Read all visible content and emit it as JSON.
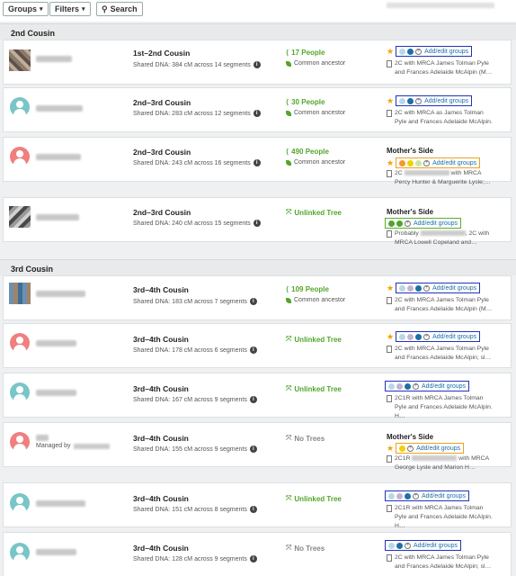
{
  "toolbar": {
    "groups_label": "Groups",
    "filters_label": "Filters",
    "search_label": "Search"
  },
  "sections": [
    {
      "title": "2nd Cousin"
    },
    {
      "title": "3rd Cousin"
    }
  ],
  "matches": [
    {
      "relationship": "1st–2nd Cousin",
      "dna": "Shared DNA: 384 cM across 14 segments",
      "tree": "17 People",
      "tree_sub": "Common ancestor",
      "side": "",
      "add_groups": "Add/edit groups",
      "note": "2C with MRCA James Tolman Pyle and Frances Adelaide McAlpin (M…"
    },
    {
      "relationship": "2nd–3rd Cousin",
      "dna": "Shared DNA: 283 cM across 12 segments",
      "tree": "30 People",
      "tree_sub": "Common ancestor",
      "side": "",
      "add_groups": "Add/edit groups",
      "note": "2C with MRCA as James Tolman Pyle and Frances Adelaide McAlpin."
    },
    {
      "relationship": "2nd–3rd Cousin",
      "dna": "Shared DNA: 243 cM across 16 segments",
      "tree": "490 People",
      "tree_sub": "Common ancestor",
      "side": "Mother's Side",
      "add_groups": "Add/edit groups",
      "note_pre": "2C",
      "note_post": "with MRCA",
      "note2": "Percy Hunter & Marguerite Lysle;…"
    },
    {
      "relationship": "2nd–3rd Cousin",
      "dna": "Shared DNA: 240 cM across 15 segments",
      "tree": "Unlinked Tree",
      "side": "Mother's Side",
      "add_groups": "Add/edit groups",
      "note_pre": "Probably",
      "note_post": ", 2C",
      "note2": "with MRCA Lowell Copeland and…"
    },
    {
      "relationship": "3rd–4th Cousin",
      "dna": "Shared DNA: 183 cM across 7 segments",
      "tree": "109 People",
      "tree_sub": "Common ancestor",
      "side": "",
      "add_groups": "Add/edit groups",
      "note": "2C with MRCA James Tolman Pyle and Frances Adelaide McAlpin (M…"
    },
    {
      "relationship": "3rd–4th Cousin",
      "dna": "Shared DNA: 178 cM across 6 segments",
      "tree": "Unlinked Tree",
      "side": "",
      "add_groups": "Add/edit groups",
      "note": "2C with MRCA James Tolman Pyle and Frances Adelaide McAlpin; sl…"
    },
    {
      "relationship": "3rd–4th Cousin",
      "dna": "Shared DNA: 167 cM across 9 segments",
      "tree": "Unlinked Tree",
      "side": "",
      "add_groups": "Add/edit groups",
      "note": "2C1R with MRCA James Tolman Pyle and Frances Adelaide McAlpin. H…"
    },
    {
      "relationship": "3rd–4th Cousin",
      "dna": "Shared DNA: 155 cM across 9 segments",
      "tree": "No Trees",
      "side": "Mother's Side",
      "add_groups": "Add/edit groups",
      "managed_by": "Managed by",
      "note": "2C1R",
      "note2": "with MRCA George Lysle and Marion H…"
    },
    {
      "relationship": "3rd–4th Cousin",
      "dna": "Shared DNA: 151 cM across 8 segments",
      "tree": "Unlinked Tree",
      "side": "",
      "add_groups": "Add/edit groups",
      "note": "2C1R with MRCA James Tolman Pyle and Frances Adelaide McAlpin. H…"
    },
    {
      "relationship": "3rd–4th Cousin",
      "dna": "Shared DNA: 128 cM across 9 segments",
      "tree": "No Trees",
      "side": "",
      "add_groups": "Add/edit groups",
      "note": "2C with MRCA James Tolman Pyle and Frances Adelaide McAlpin; sl…"
    }
  ],
  "colors": {
    "green": "#53a62c",
    "link": "#1a6fa8",
    "star": "#f4a100",
    "highlight_blue": "#2233bb",
    "highlight_orange": "#f0a020",
    "highlight_green": "#5aae2c"
  }
}
